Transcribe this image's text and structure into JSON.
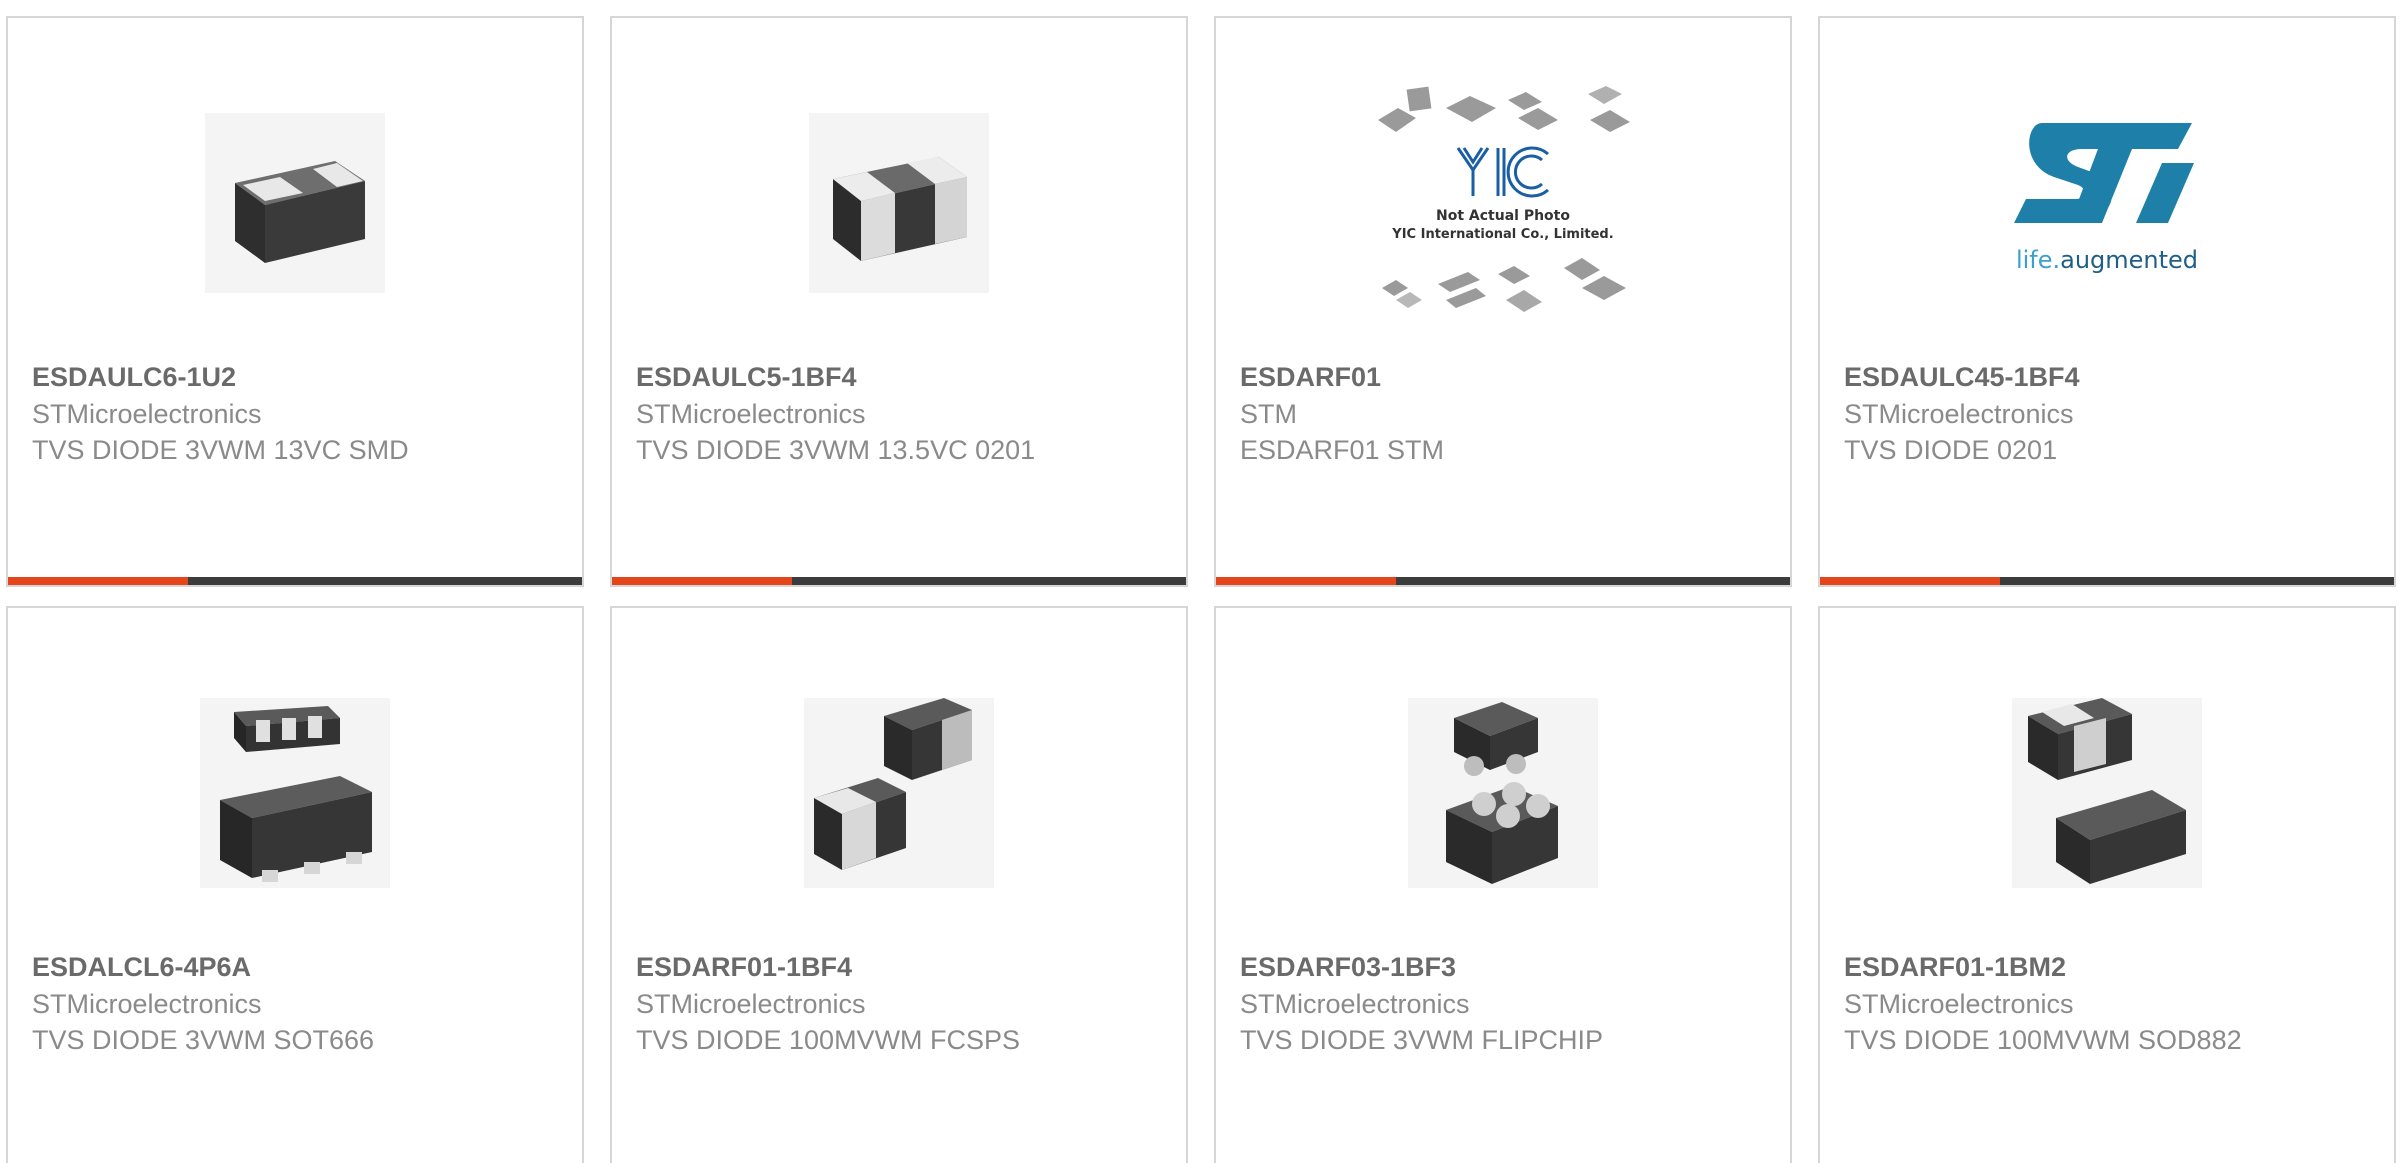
{
  "products": [
    {
      "part_number": "ESDAULC6-1U2",
      "manufacturer": "STMicroelectronics",
      "description": "TVS DIODE 3VWM 13VC SMD",
      "image_icon": "two-terminal-chip-icon"
    },
    {
      "part_number": "ESDAULC5-1BF4",
      "manufacturer": "STMicroelectronics",
      "description": "TVS DIODE 3VWM 13.5VC 0201",
      "image_icon": "two-terminal-chip-icon"
    },
    {
      "part_number": "ESDARF01",
      "manufacturer": "STM",
      "description": "ESDARF01 STM",
      "image_icon": "placeholder-photo-icon",
      "placeholder": {
        "brand": "YIC",
        "line1": "Not Actual Photo",
        "line2": "YIC International Co., Limited."
      }
    },
    {
      "part_number": "ESDAULC45-1BF4",
      "manufacturer": "STMicroelectronics",
      "description": "TVS DIODE 0201",
      "image_icon": "st-logo-icon",
      "logo": {
        "tagline_prefix": "life.",
        "tagline_suffix": "augmented"
      }
    },
    {
      "part_number": "ESDALCL6-4P6A",
      "manufacturer": "STMicroelectronics",
      "description": "TVS DIODE 3VWM SOT666",
      "image_icon": "sot666-package-icon"
    },
    {
      "part_number": "ESDARF01-1BF4",
      "manufacturer": "STMicroelectronics",
      "description": "TVS DIODE 100MVWM FCSPS",
      "image_icon": "two-chip-package-icon"
    },
    {
      "part_number": "ESDARF03-1BF3",
      "manufacturer": "STMicroelectronics",
      "description": "TVS DIODE 3VWM FLIPCHIP",
      "image_icon": "flipchip-package-icon"
    },
    {
      "part_number": "ESDARF01-1BM2",
      "manufacturer": "STMicroelectronics",
      "description": "TVS DIODE 100MVWM SOD882",
      "image_icon": "sod882-package-icon"
    }
  ],
  "colors": {
    "accent": "#e4451b",
    "bar": "#3c3c3c",
    "border": "#d6d6d6",
    "title_text": "#6a6a6a",
    "body_text": "#8a8a8a",
    "st_logo_blue": "#1e7fa8"
  }
}
